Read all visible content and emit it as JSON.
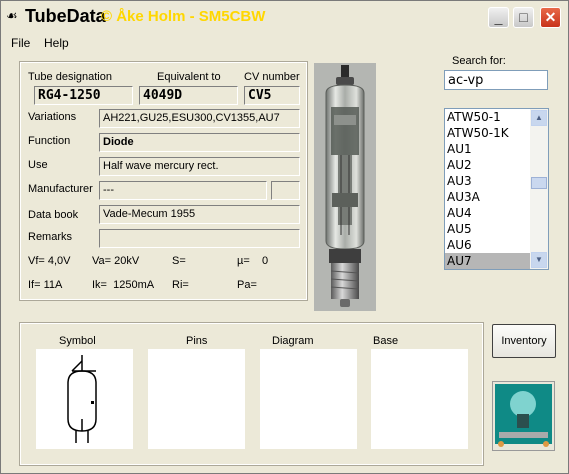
{
  "window": {
    "title": "TubeData",
    "title_overlay": "© Åke Holm - SM5CBW",
    "min_glyph": "_",
    "max_glyph": "□",
    "close_glyph": "✕"
  },
  "menu": {
    "file": "File",
    "help": "Help"
  },
  "labels": {
    "designation": "Tube designation",
    "equivalent": "Equivalent to",
    "cv_number": "CV number",
    "variations": "Variations",
    "function": "Function",
    "use": "Use",
    "manufacturer": "Manufacturer",
    "data_book": "Data book",
    "remarks": "Remarks",
    "search": "Search for:",
    "symbol": "Symbol",
    "pins": "Pins",
    "diagram": "Diagram",
    "base": "Base",
    "inventory": "Inventory"
  },
  "values": {
    "designation": "RG4-1250",
    "equivalent": "4049D",
    "cv_number": "CV5",
    "variations": "AH221,GU25,ESU300,CV1355,AU7",
    "function": "Diode",
    "use": "Half wave mercury rect.",
    "manufacturer": "---",
    "manufacturer_extra": "",
    "data_book": "Vade-Mecum 1955",
    "remarks": "",
    "vf": "Vf= 4,0V",
    "va": "Va= 20kV",
    "s": "S=",
    "mu": "µ=    0",
    "if": "If= 11A",
    "ik": "Ik=  1250mA",
    "ri": "Ri=",
    "pa": "Pa="
  },
  "search": {
    "value": "ac-vp"
  },
  "tube_list": {
    "items": [
      "ATW50-1",
      "ATW50-1K",
      "AU1",
      "AU2",
      "AU3",
      "AU3A",
      "AU4",
      "AU5",
      "AU6",
      "AU7"
    ],
    "selected": "AU7"
  },
  "icons": {
    "app": "tube-icon",
    "scroll_up": "▲",
    "scroll_down": "▼"
  },
  "colors": {
    "title_overlay": "#ffd700",
    "close_button": "#d8472a"
  }
}
